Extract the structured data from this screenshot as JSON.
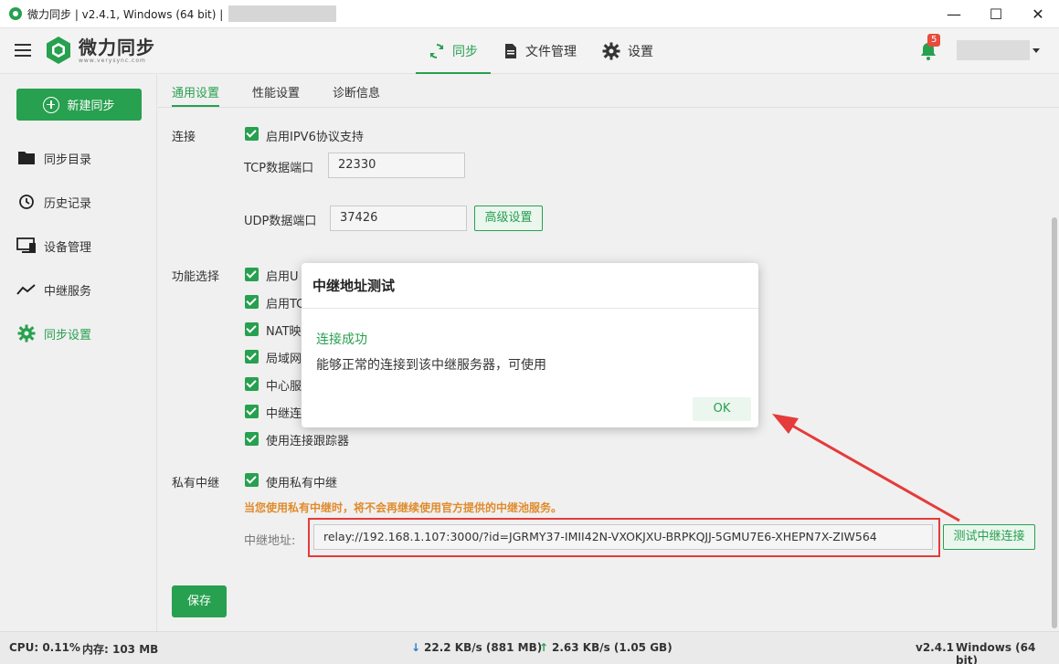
{
  "window": {
    "title": "微力同步 | v2.4.1, Windows (64 bit) |",
    "minimize": "—",
    "maximize": "☐",
    "close": "✕"
  },
  "header": {
    "brand_name": "微力同步",
    "brand_sub": "www.verysync.com",
    "nav": [
      {
        "label": "同步",
        "icon": "sync-icon"
      },
      {
        "label": "文件管理",
        "icon": "file-icon"
      },
      {
        "label": "设置",
        "icon": "gear-icon"
      }
    ],
    "notification_count": "5"
  },
  "sidebar": {
    "new_sync": "新建同步",
    "items": [
      {
        "label": "同步目录",
        "icon": "folder-icon"
      },
      {
        "label": "历史记录",
        "icon": "history-icon"
      },
      {
        "label": "设备管理",
        "icon": "device-icon"
      },
      {
        "label": "中继服务",
        "icon": "relay-icon"
      },
      {
        "label": "同步设置",
        "icon": "gear-icon"
      }
    ]
  },
  "subtabs": [
    "通用设置",
    "性能设置",
    "诊断信息"
  ],
  "settings": {
    "connection_label": "连接",
    "ipv6_label": "启用IPV6协议支持",
    "tcp_label": "TCP数据端口",
    "tcp_value": "22330",
    "udp_label": "UDP数据端口",
    "udp_value": "37426",
    "advanced_btn": "高级设置",
    "feature_label": "功能选择",
    "features": [
      "启用U",
      "启用TC",
      "NAT映",
      "局域网",
      "中心服",
      "中继连",
      "使用连接跟踪器"
    ],
    "private_relay_label": "私有中继",
    "use_private_relay": "使用私有中继",
    "warning": "当您使用私有中继时，将不会再继续使用官方提供的中继池服务。",
    "relay_addr_label": "中继地址:",
    "relay_addr_value": "relay://192.168.1.107:3000/?id=JGRMY37-IMII42N-VXOKJXU-BRPKQJJ-5GMU7E6-XHEPN7X-ZIW564",
    "test_relay_btn": "测试中继连接",
    "save_btn": "保存"
  },
  "modal": {
    "title": "中继地址测试",
    "success": "连接成功",
    "message": "能够正常的连接到该中继服务器，可使用",
    "ok": "OK"
  },
  "statusbar": {
    "cpu": "CPU: 0.11%",
    "memory": "内存: 103 MB",
    "download": "22.2 KB/s (881 MB)",
    "upload": "2.63 KB/s (1.05 GB)",
    "version": "v2.4.1",
    "os": "Windows (64 bit)"
  },
  "colors": {
    "accent": "#27a04f",
    "warning": "#e08b2c",
    "highlight": "#e53b3b"
  }
}
